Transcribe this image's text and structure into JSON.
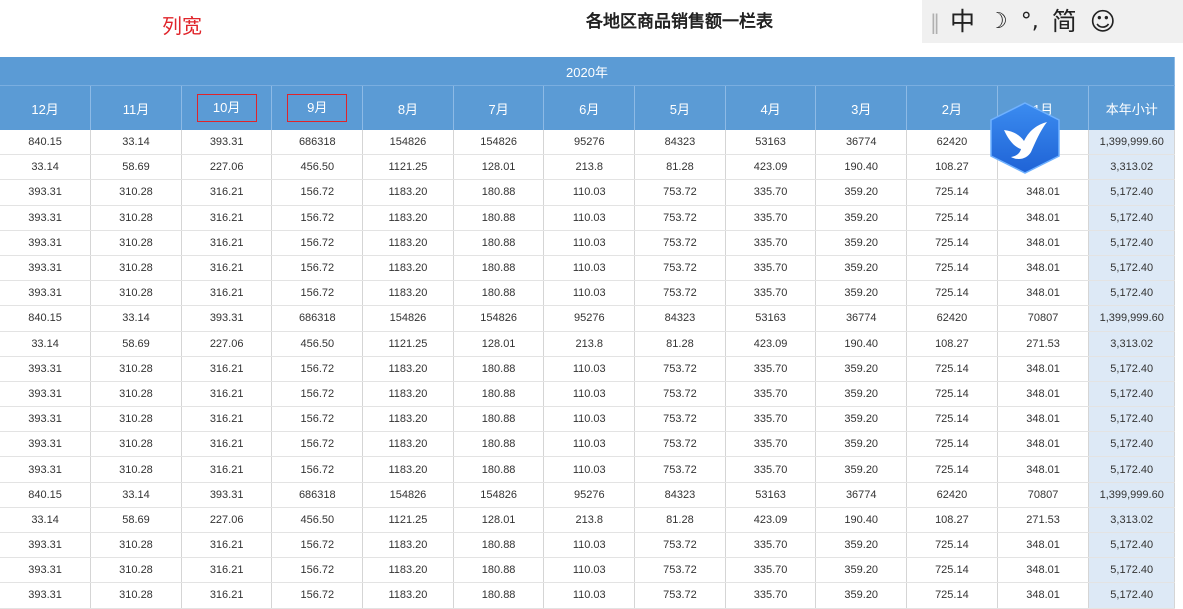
{
  "annotation_label": "列宽",
  "page_title": "各地区商品销售额一栏表",
  "ime": {
    "items": [
      "中",
      "☽",
      "°,",
      "简",
      "☺"
    ]
  },
  "table": {
    "year_header": "2020年",
    "columns": [
      "12月",
      "11月",
      "10月",
      "9月",
      "8月",
      "7月",
      "6月",
      "5月",
      "4月",
      "3月",
      "2月",
      "1月",
      "本年小计"
    ],
    "rows": [
      [
        "840.15",
        "33.14",
        "393.31",
        "686318",
        "154826",
        "154826",
        "95276",
        "84323",
        "53163",
        "36774",
        "62420",
        "",
        "1,399,999.60"
      ],
      [
        "33.14",
        "58.69",
        "227.06",
        "456.50",
        "1121.25",
        "128.01",
        "213.8",
        "81.28",
        "423.09",
        "190.40",
        "108.27",
        "",
        "3,313.02"
      ],
      [
        "393.31",
        "310.28",
        "316.21",
        "156.72",
        "1183.20",
        "180.88",
        "110.03",
        "753.72",
        "335.70",
        "359.20",
        "725.14",
        "348.01",
        "5,172.40"
      ],
      [
        "393.31",
        "310.28",
        "316.21",
        "156.72",
        "1183.20",
        "180.88",
        "110.03",
        "753.72",
        "335.70",
        "359.20",
        "725.14",
        "348.01",
        "5,172.40"
      ],
      [
        "393.31",
        "310.28",
        "316.21",
        "156.72",
        "1183.20",
        "180.88",
        "110.03",
        "753.72",
        "335.70",
        "359.20",
        "725.14",
        "348.01",
        "5,172.40"
      ],
      [
        "393.31",
        "310.28",
        "316.21",
        "156.72",
        "1183.20",
        "180.88",
        "110.03",
        "753.72",
        "335.70",
        "359.20",
        "725.14",
        "348.01",
        "5,172.40"
      ],
      [
        "393.31",
        "310.28",
        "316.21",
        "156.72",
        "1183.20",
        "180.88",
        "110.03",
        "753.72",
        "335.70",
        "359.20",
        "725.14",
        "348.01",
        "5,172.40"
      ],
      [
        "840.15",
        "33.14",
        "393.31",
        "686318",
        "154826",
        "154826",
        "95276",
        "84323",
        "53163",
        "36774",
        "62420",
        "70807",
        "1,399,999.60"
      ],
      [
        "33.14",
        "58.69",
        "227.06",
        "456.50",
        "1121.25",
        "128.01",
        "213.8",
        "81.28",
        "423.09",
        "190.40",
        "108.27",
        "271.53",
        "3,313.02"
      ],
      [
        "393.31",
        "310.28",
        "316.21",
        "156.72",
        "1183.20",
        "180.88",
        "110.03",
        "753.72",
        "335.70",
        "359.20",
        "725.14",
        "348.01",
        "5,172.40"
      ],
      [
        "393.31",
        "310.28",
        "316.21",
        "156.72",
        "1183.20",
        "180.88",
        "110.03",
        "753.72",
        "335.70",
        "359.20",
        "725.14",
        "348.01",
        "5,172.40"
      ],
      [
        "393.31",
        "310.28",
        "316.21",
        "156.72",
        "1183.20",
        "180.88",
        "110.03",
        "753.72",
        "335.70",
        "359.20",
        "725.14",
        "348.01",
        "5,172.40"
      ],
      [
        "393.31",
        "310.28",
        "316.21",
        "156.72",
        "1183.20",
        "180.88",
        "110.03",
        "753.72",
        "335.70",
        "359.20",
        "725.14",
        "348.01",
        "5,172.40"
      ],
      [
        "393.31",
        "310.28",
        "316.21",
        "156.72",
        "1183.20",
        "180.88",
        "110.03",
        "753.72",
        "335.70",
        "359.20",
        "725.14",
        "348.01",
        "5,172.40"
      ],
      [
        "840.15",
        "33.14",
        "393.31",
        "686318",
        "154826",
        "154826",
        "95276",
        "84323",
        "53163",
        "36774",
        "62420",
        "70807",
        "1,399,999.60"
      ],
      [
        "33.14",
        "58.69",
        "227.06",
        "456.50",
        "1121.25",
        "128.01",
        "213.8",
        "81.28",
        "423.09",
        "190.40",
        "108.27",
        "271.53",
        "3,313.02"
      ],
      [
        "393.31",
        "310.28",
        "316.21",
        "156.72",
        "1183.20",
        "180.88",
        "110.03",
        "753.72",
        "335.70",
        "359.20",
        "725.14",
        "348.01",
        "5,172.40"
      ],
      [
        "393.31",
        "310.28",
        "316.21",
        "156.72",
        "1183.20",
        "180.88",
        "110.03",
        "753.72",
        "335.70",
        "359.20",
        "725.14",
        "348.01",
        "5,172.40"
      ],
      [
        "393.31",
        "310.28",
        "316.21",
        "156.72",
        "1183.20",
        "180.88",
        "110.03",
        "753.72",
        "335.70",
        "359.20",
        "725.14",
        "348.01",
        "5,172.40"
      ]
    ]
  },
  "colors": {
    "header_bg": "#5b9bd5",
    "subtotal_bg": "#dde9f6",
    "highlight": "#e0242a"
  },
  "overlay_icon": "bird-app-icon"
}
